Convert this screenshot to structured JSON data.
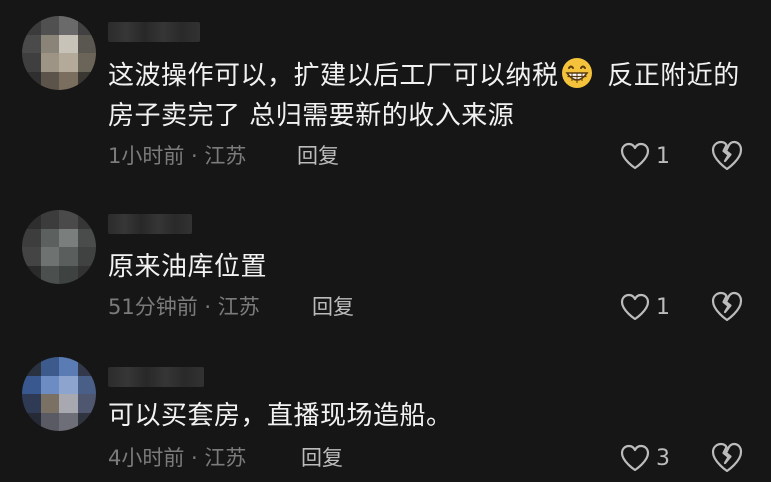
{
  "comments": [
    {
      "text": "这波操作可以，扩建以后工厂可以纳税",
      "text_after_emoji": " 反正附近的房子卖完了 总归需要新的收入来源",
      "emoji": "grinning-face-icon",
      "time_location": "1小时前 · 江苏",
      "reply_label": "回复",
      "likes": "1"
    },
    {
      "text": "原来油库位置",
      "time_location": "51分钟前 · 江苏",
      "reply_label": "回复",
      "likes": "1"
    },
    {
      "text": "可以买套房，直播现场造船。",
      "time_location": "4小时前 · 江苏",
      "reply_label": "回复",
      "likes": "3"
    }
  ],
  "colors": {
    "background": "#161616",
    "text": "#f2f2f2",
    "meta": "#7b7b7b",
    "action": "#bcbcbc",
    "emoji": "#f5c33b"
  }
}
